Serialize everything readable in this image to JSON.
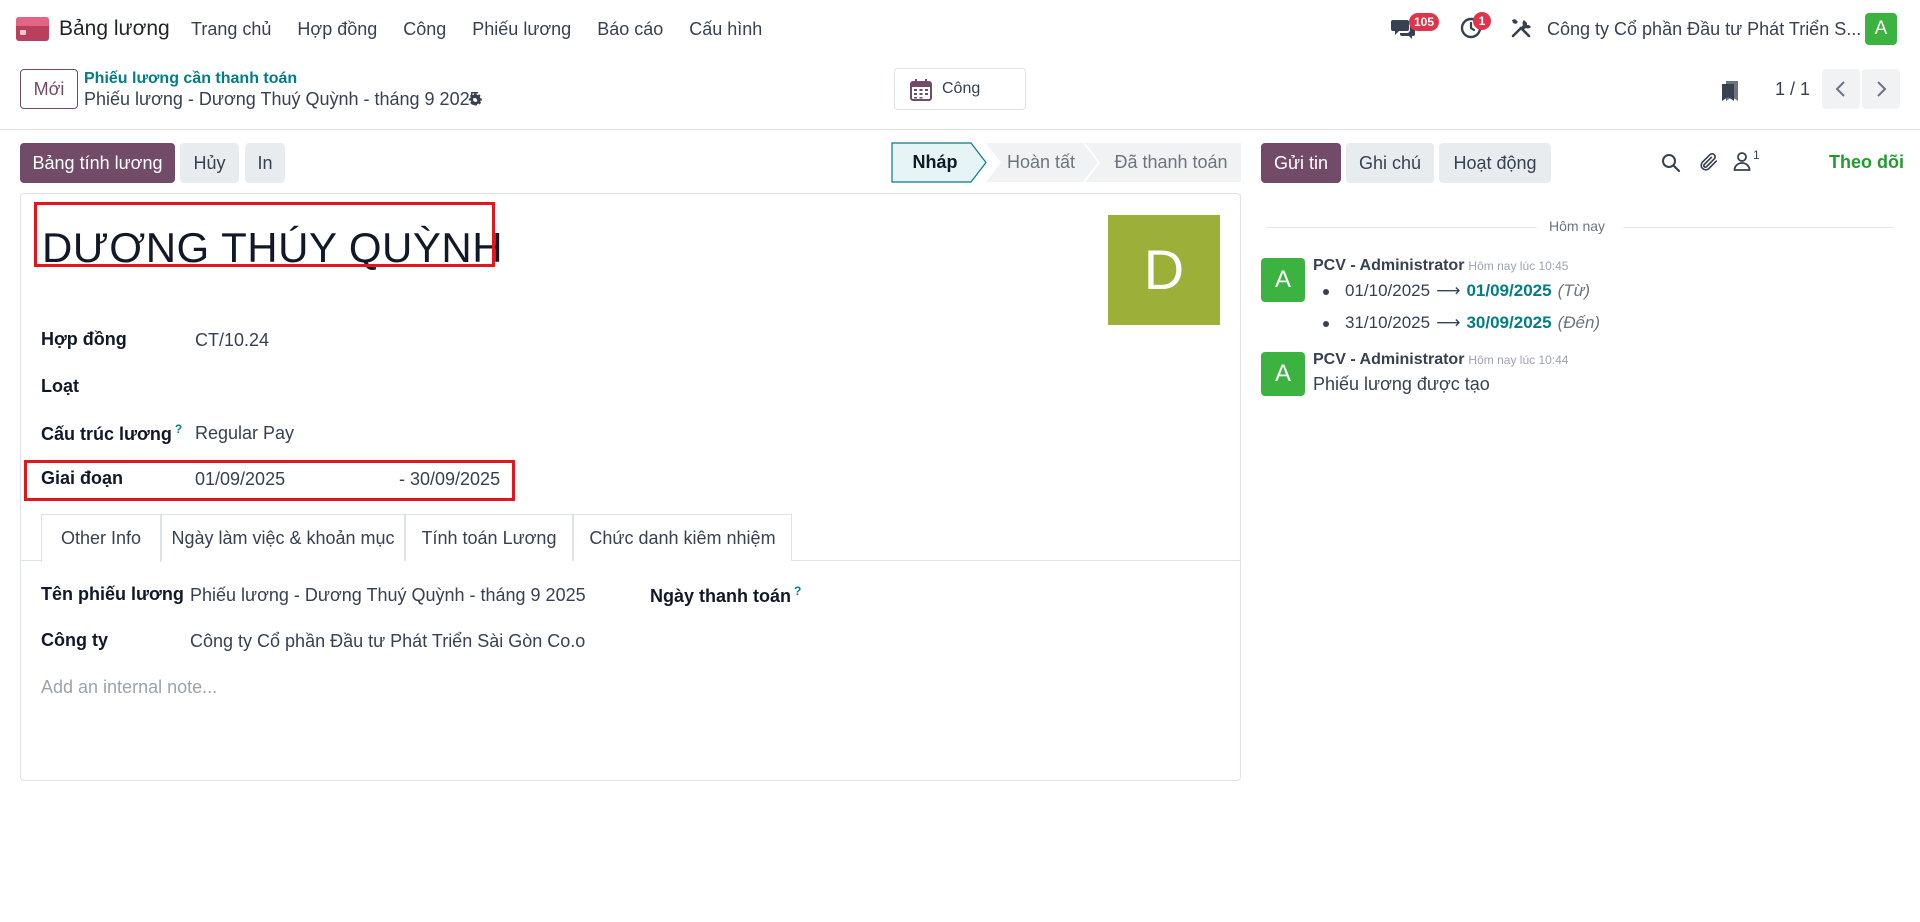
{
  "navbar": {
    "app_name": "Bảng lương",
    "menu": [
      "Trang chủ",
      "Hợp đồng",
      "Công",
      "Phiếu lương",
      "Báo cáo",
      "Cấu hình"
    ],
    "messages_badge": "105",
    "activities_badge": "1",
    "company": "Công ty Cổ phần Đầu tư Phát Triển S...",
    "user_initial": "A"
  },
  "control": {
    "new_button": "Mới",
    "breadcrumb_parent": "Phiếu lương cần thanh toán",
    "breadcrumb_current": "Phiếu lương - Dương Thuý Quỳnh - tháng 9 2025",
    "smart_button": "Công",
    "pager": "1 / 1"
  },
  "actions": {
    "compute_sheet": "Bảng tính lương",
    "cancel": "Hủy",
    "print": "In"
  },
  "status": {
    "steps": [
      "Nháp",
      "Hoàn tất",
      "Đã thanh toán"
    ],
    "active_index": 0
  },
  "form": {
    "employee_name": "DƯƠNG THÚY QUỲNH",
    "avatar_initial": "D",
    "avatar_color": "#9caf38",
    "fields": {
      "contract_label": "Hợp đồng",
      "contract_value": "CT/10.24",
      "batch_label": "Loạt",
      "structure_label": "Cấu trúc lương",
      "structure_help": "?",
      "structure_value": "Regular Pay",
      "period_label": "Giai đoạn",
      "period_from": "01/09/2025",
      "period_to": "- 30/09/2025"
    },
    "tabs": [
      "Other Info",
      "Ngày làm việc & khoản mục",
      "Tính toán Lương",
      "Chức danh kiêm nhiệm"
    ],
    "active_tab": 0,
    "other_info": {
      "payslip_name_label": "Tên phiếu lương",
      "payslip_name_value": "Phiếu lương - Dương Thuý Quỳnh - tháng 9 2025",
      "company_label": "Công ty",
      "company_value": "Công ty Cổ phần Đầu tư Phát Triển Sài Gòn Co.o",
      "payment_date_label": "Ngày thanh toán",
      "payment_date_help": "?",
      "note_placeholder": "Add an internal note..."
    }
  },
  "chatter": {
    "send_message": "Gửi tin",
    "log_note": "Ghi chú",
    "activities": "Hoạt động",
    "followers_count": "1",
    "follow": "Theo dõi",
    "today": "Hôm nay",
    "messages": [
      {
        "avatar": "A",
        "author": "PCV - Administrator",
        "time": "Hôm nay lúc 10:45",
        "changes": [
          {
            "old": "01/10/2025",
            "new": "01/09/2025",
            "field": "(Từ)"
          },
          {
            "old": "31/10/2025",
            "new": "30/09/2025",
            "field": "(Đến)"
          }
        ]
      },
      {
        "avatar": "A",
        "author": "PCV - Administrator",
        "time": "Hôm nay lúc 10:44",
        "body": "Phiếu lương được tạo"
      }
    ]
  },
  "colors": {
    "brand": "#714b67",
    "link": "#017e84",
    "highlight_box": "#e4161b",
    "follow": "#1f9d2c",
    "avatar_user": "#3cb340",
    "badge": "#e0344b"
  }
}
